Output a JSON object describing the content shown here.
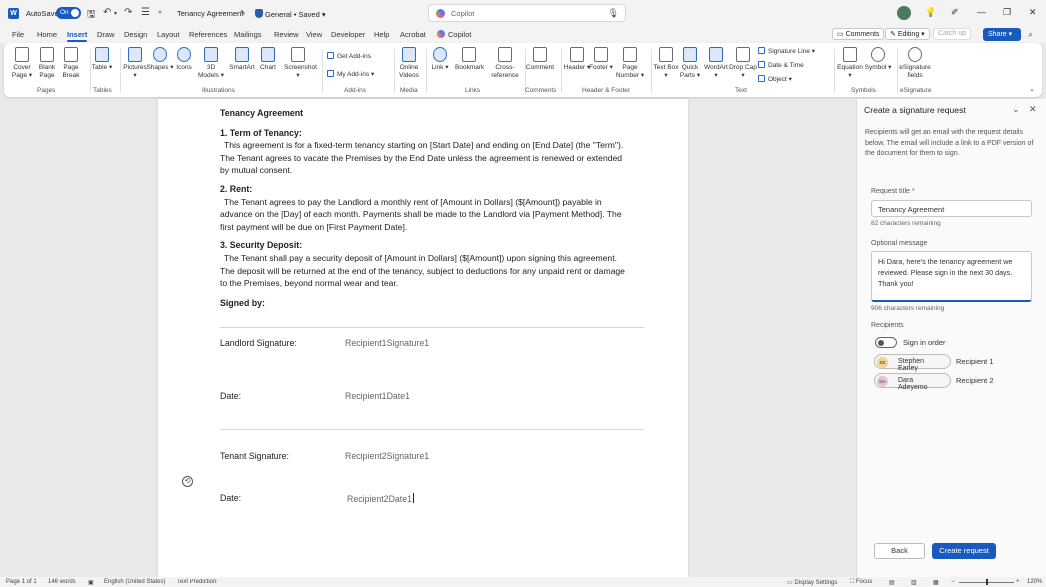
{
  "titlebar": {
    "app_letter": "W",
    "autosave_label": "AutoSave",
    "autosave_state": "On",
    "doc_title": "Tenancy Agreement",
    "sensitivity": "General • Saved",
    "search_placeholder": "Copilot"
  },
  "menu": {
    "tabs": [
      "File",
      "Home",
      "Insert",
      "Draw",
      "Design",
      "Layout",
      "References",
      "Mailings",
      "Review",
      "View",
      "Developer",
      "Help",
      "Acrobat"
    ],
    "active_tab": "Insert",
    "copilot": "Copilot",
    "comments": "Comments",
    "editing": "Editing",
    "catchup": "Catch up",
    "share": "Share"
  },
  "ribbon": {
    "pages": [
      "Cover Page",
      "Blank Page",
      "Page Break"
    ],
    "table": "Table",
    "illustrations": [
      "Pictures",
      "Shapes",
      "Icons",
      "3D Models",
      "SmartArt",
      "Chart",
      "Screenshot"
    ],
    "addins": [
      "Get Add-ins",
      "My Add-ins"
    ],
    "media": "Online Videos",
    "links": [
      "Link",
      "Bookmark",
      "Cross-reference"
    ],
    "comment": "Comment",
    "header_footer": [
      "Header",
      "Footer",
      "Page Number"
    ],
    "text": [
      "Text Box",
      "Quick Parts",
      "WordArt",
      "Drop Cap"
    ],
    "text_small": [
      "Signature Line",
      "Date & Time",
      "Object"
    ],
    "symbols": [
      "Equation",
      "Symbol"
    ],
    "esign": "eSignature fields",
    "groups": [
      "Pages",
      "Tables",
      "Illustrations",
      "Add-ins",
      "Media",
      "Links",
      "Comments",
      "Header & Footer",
      "Text",
      "Symbols",
      "eSignature"
    ]
  },
  "document": {
    "title": "Tenancy Agreement",
    "s1_heading": "1. Term of Tenancy:",
    "s1_body": "This agreement is for a fixed-term tenancy starting on [Start Date] and ending on [End Date] (the \"Term\"). The Tenant agrees to vacate the Premises by the End Date unless the agreement is renewed or extended by mutual consent.",
    "s2_heading": "2. Rent:",
    "s2_body": "The Tenant agrees to pay the Landlord a monthly rent of [Amount in Dollars] ($[Amount]) payable in advance on the [Day] of each month.    Payments shall be made to the Landlord via [Payment Method]. The first payment will be due on [First Payment Date].",
    "s3_heading": "3. Security Deposit:",
    "s3_body": "The Tenant shall pay a security deposit of [Amount in Dollars] ($[Amount]) upon signing this agreement. The deposit will be returned at the end of the tenancy, subject to deductions for any unpaid rent or damage to the Premises, beyond normal wear and tear.",
    "signed_by": "Signed by:",
    "landlord_sig_label": "Landlord Signature:",
    "landlord_sig_field": "Recipient1Signature1",
    "date1_label": "Date:",
    "date1_field": "Recipient1Date1",
    "tenant_sig_label": "Tenant Signature:",
    "tenant_sig_field": "Recipient2Signature1",
    "date2_label": "Date:",
    "date2_field": "Recipient2Date1"
  },
  "pane": {
    "title": "Create a signature request",
    "description": "Recipients will get an email with the request details below. The email will include a link to a PDF version of the document for them to sign.",
    "request_title_label": "Request title",
    "request_title_value": "Tenancy Agreement",
    "request_title_hint": "82 characters remaining",
    "message_label": "Optional message",
    "message_value": "Hi Dara, here's the tenancy agreement we reviewed. Please sign in the next 30 days. Thank you!",
    "message_hint": "906 characters remaining",
    "recipients_label": "Recipients",
    "sign_in_order": "Sign in order",
    "recipients": [
      {
        "initials": "SE",
        "name": "Stephen Earley",
        "role": "Recipient 1",
        "color": "#f2d28c"
      },
      {
        "initials": "DA",
        "name": "Dara Adeyemo",
        "role": "Recipient 2",
        "color": "#e8c3d6"
      }
    ],
    "back": "Back",
    "create": "Create request"
  },
  "status": {
    "page": "Page 1 of 1",
    "words": "146 words",
    "language": "English (United States)",
    "prediction": "Text Predictions: On",
    "display": "Display Settings",
    "focus": "Focus",
    "zoom": "120%"
  },
  "colors": {
    "accent": "#185abd",
    "required": "#c4314b"
  }
}
